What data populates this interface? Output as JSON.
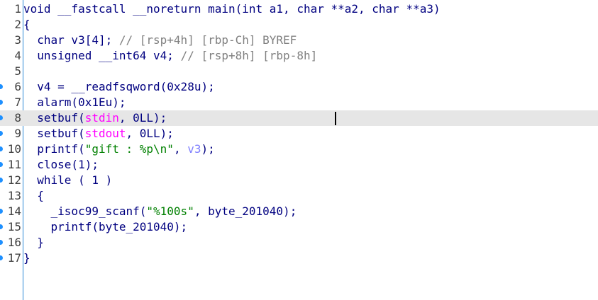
{
  "editor": {
    "lines": [
      {
        "num": "1",
        "breakpoint": false,
        "parts": [
          {
            "t": "void __fastcall __noreturn main(int a1, char **a2, char **a3)",
            "c": "kw"
          }
        ]
      },
      {
        "num": "2",
        "breakpoint": false,
        "parts": [
          {
            "t": "{",
            "c": "kw"
          }
        ]
      },
      {
        "num": "3",
        "breakpoint": false,
        "parts": [
          {
            "t": "  char v3[4]; ",
            "c": "kw"
          },
          {
            "t": "// [rsp+4h] [rbp-Ch] BYREF",
            "c": "cm"
          }
        ]
      },
      {
        "num": "4",
        "breakpoint": false,
        "parts": [
          {
            "t": "  unsigned __int64 v4; ",
            "c": "kw"
          },
          {
            "t": "// [rsp+8h] [rbp-8h]",
            "c": "cm"
          }
        ]
      },
      {
        "num": "5",
        "breakpoint": false,
        "parts": [
          {
            "t": "",
            "c": "kw"
          }
        ]
      },
      {
        "num": "6",
        "breakpoint": true,
        "parts": [
          {
            "t": "  v4 = __readfsqword(0x28u);",
            "c": "kw"
          }
        ]
      },
      {
        "num": "7",
        "breakpoint": true,
        "parts": [
          {
            "t": "  alarm(0x1Eu);",
            "c": "kw"
          }
        ]
      },
      {
        "num": "8",
        "breakpoint": true,
        "current": true,
        "parts": [
          {
            "t": "  setbuf(",
            "c": "kw"
          },
          {
            "t": "stdin",
            "c": "gl"
          },
          {
            "t": ", 0LL);",
            "c": "kw"
          }
        ]
      },
      {
        "num": "9",
        "breakpoint": true,
        "parts": [
          {
            "t": "  setbuf(",
            "c": "kw"
          },
          {
            "t": "stdout",
            "c": "gl"
          },
          {
            "t": ", 0LL);",
            "c": "kw"
          }
        ]
      },
      {
        "num": "10",
        "breakpoint": true,
        "parts": [
          {
            "t": "  printf(",
            "c": "kw"
          },
          {
            "t": "\"gift : %p\\n\"",
            "c": "str"
          },
          {
            "t": ", ",
            "c": "kw"
          },
          {
            "t": "v3",
            "c": "var"
          },
          {
            "t": ");",
            "c": "kw"
          }
        ]
      },
      {
        "num": "11",
        "breakpoint": true,
        "parts": [
          {
            "t": "  close(1);",
            "c": "kw"
          }
        ]
      },
      {
        "num": "12",
        "breakpoint": true,
        "parts": [
          {
            "t": "  while ( 1 )",
            "c": "kw"
          }
        ]
      },
      {
        "num": "13",
        "breakpoint": false,
        "parts": [
          {
            "t": "  {",
            "c": "kw"
          }
        ]
      },
      {
        "num": "14",
        "breakpoint": true,
        "parts": [
          {
            "t": "    _isoc99_scanf(",
            "c": "kw"
          },
          {
            "t": "\"%100s\"",
            "c": "str"
          },
          {
            "t": ", byte_201040);",
            "c": "kw"
          }
        ]
      },
      {
        "num": "15",
        "breakpoint": true,
        "parts": [
          {
            "t": "    printf(byte_201040);",
            "c": "kw"
          }
        ]
      },
      {
        "num": "16",
        "breakpoint": true,
        "parts": [
          {
            "t": "  }",
            "c": "kw"
          }
        ]
      },
      {
        "num": "17",
        "breakpoint": true,
        "parts": [
          {
            "t": "}",
            "c": "kw"
          }
        ]
      }
    ]
  }
}
